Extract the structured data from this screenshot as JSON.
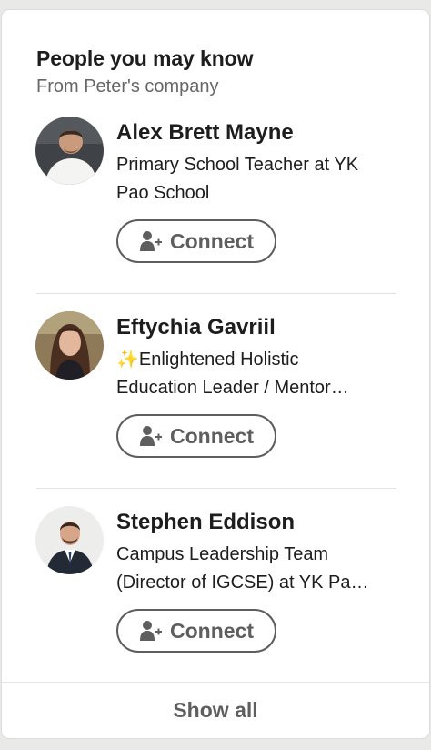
{
  "card": {
    "title": "People you may know",
    "subtitle": "From Peter's company"
  },
  "people": [
    {
      "name": "Alex Brett Mayne",
      "headline": "Primary School Teacher at YK\nPao School",
      "connect_label": "Connect",
      "connect_icon": "add-person-icon"
    },
    {
      "name": "Eftychia Gavriil",
      "headline": "✨Enlightened Holistic\nEducation Leader / Mentor…",
      "connect_label": "Connect",
      "connect_icon": "add-person-icon"
    },
    {
      "name": "Stephen Eddison",
      "headline": "Campus Leadership Team\n(Director of IGCSE) at YK Pa…",
      "connect_label": "Connect",
      "connect_icon": "add-person-icon"
    }
  ],
  "footer": {
    "show_all_label": "Show all"
  },
  "colors": {
    "button_outline": "#5e5e5e",
    "title_text": "#1d1d1d",
    "subtitle_text": "#676767",
    "divider": "#e3e3e3"
  }
}
